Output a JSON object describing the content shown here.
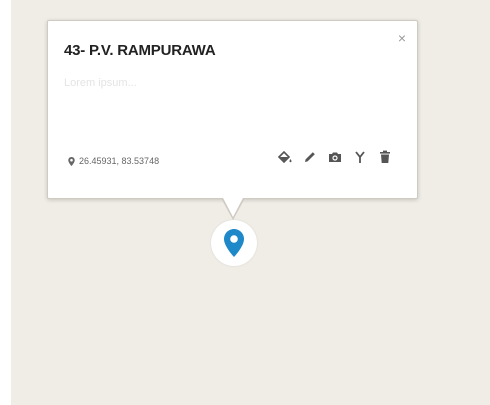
{
  "popup": {
    "title": "43- P.V. RAMPURAWA",
    "subtitle": "Lorem ipsum...",
    "close_symbol": "×",
    "coordinates": "26.45931, 83.53748"
  },
  "toolbar": {
    "tools": [
      {
        "name": "fill-color",
        "icon": "paint-bucket-icon"
      },
      {
        "name": "edit",
        "icon": "pencil-icon"
      },
      {
        "name": "photo",
        "icon": "camera-icon"
      },
      {
        "name": "route",
        "icon": "fork-icon"
      },
      {
        "name": "delete",
        "icon": "trash-icon"
      }
    ]
  },
  "colors": {
    "map_background": "#efede6",
    "marker": "#1e88c9",
    "icon": "#555555"
  },
  "marker": {
    "icon": "map-pin-icon"
  }
}
